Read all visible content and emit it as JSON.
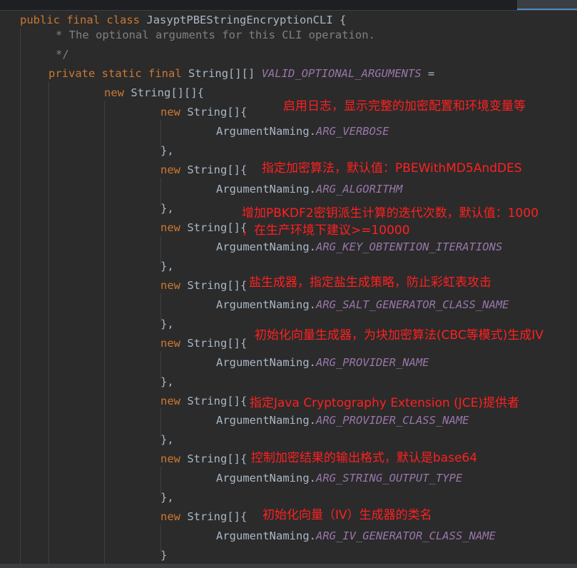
{
  "code": {
    "class_decl": {
      "kw1": "public",
      "kw2": "final",
      "kw3": "class",
      "name": "JasyptPBEStringEncryptionCLI",
      "brace": "{"
    },
    "comment_line": "* The optional arguments for this CLI operation.",
    "comment_end": "*/",
    "field_decl": {
      "kw1": "private",
      "kw2": "static",
      "kw3": "final",
      "type": "String[][]",
      "name": "VALID_OPTIONAL_ARGUMENTS",
      "op": "="
    },
    "outer_new": {
      "kw": "new",
      "type": "String[][]{"
    },
    "inner_new": {
      "kw": "new",
      "type": "String[]{"
    },
    "arg_prefix": "ArgumentNaming.",
    "close_comma": "},",
    "close_last": "}",
    "args": [
      "ARG_VERBOSE",
      "ARG_ALGORITHM",
      "ARG_KEY_OBTENTION_ITERATIONS",
      "ARG_SALT_GENERATOR_CLASS_NAME",
      "ARG_PROVIDER_NAME",
      "ARG_PROVIDER_CLASS_NAME",
      "ARG_STRING_OUTPUT_TYPE",
      "ARG_IV_GENERATOR_CLASS_NAME"
    ]
  },
  "annotations": {
    "verbose": "启用日志，显示完整的加密配置和环境变量等",
    "algorithm": "指定加密算法，默认值：PBEWithMD5AndDES",
    "iterations_1": "增加PBKDF2密钥派生计算的迭代次数，默认值：1000",
    "iterations_2": "，在生产环境下建议>=10000",
    "salt": "盐生成器，指定盐生成策略，防止彩虹表攻击",
    "provider_name": "初始化向量生成器，为块加密算法(CBC等模式)生成IV",
    "provider_class": "指定Java Cryptography Extension (JCE)提供者",
    "output_type": "控制加密结果的输出格式，默认是base64",
    "iv_generator": "初始化向量（IV）生成器的类名"
  },
  "colors": {
    "background": "#2b2b2b",
    "keyword": "#cc7832",
    "plain": "#a9b7c6",
    "comment": "#808080",
    "field": "#9876aa",
    "annotation": "#ff2020"
  }
}
